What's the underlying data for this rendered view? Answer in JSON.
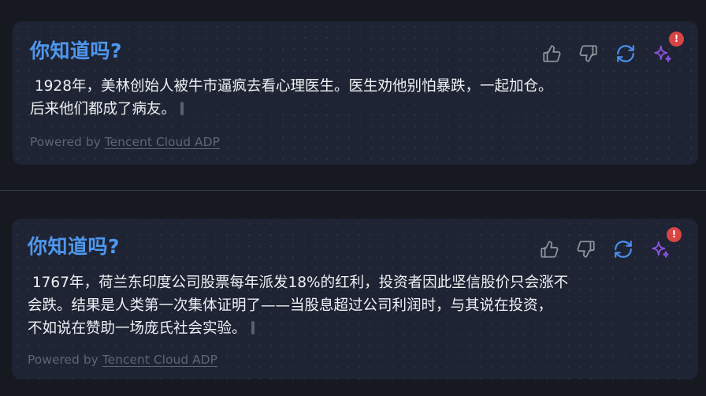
{
  "colors": {
    "background": "#16191f",
    "card": "#1e2433",
    "title": "#4f97ef",
    "body_text": "#eef0f4",
    "footer": "#5f6572",
    "icon_gray": "#8d929b",
    "refresh_blue": "#4a8ff0",
    "sparkle_purple": "#8c52e0",
    "badge_red": "#d84444"
  },
  "cards": [
    {
      "title": "你知道吗?",
      "lines": [
        " 1928年，美林创始人被牛市逼疯去看心理医生。医生劝他别怕暴跌，一起加仓。",
        "后来他们都成了病友。"
      ],
      "footer_prefix": "Powered by ",
      "footer_link": "Tencent Cloud ADP",
      "actions": {
        "like_icon": "thumbs-up-icon",
        "dislike_icon": "thumbs-down-icon",
        "refresh_icon": "refresh-icon",
        "sparkle_icon": "sparkle-icon",
        "badge": "!"
      }
    },
    {
      "title": "你知道吗?",
      "lines": [
        " 1767年，荷兰东印度公司股票每年派发18%的红利，投资者因此坚信股价只会涨不",
        "会跌。结果是人类第一次集体证明了——当股息超过公司利润时，与其说在投资，",
        "不如说在赞助一场庞氏社会实验。"
      ],
      "footer_prefix": "Powered by ",
      "footer_link": "Tencent Cloud ADP",
      "actions": {
        "like_icon": "thumbs-up-icon",
        "dislike_icon": "thumbs-down-icon",
        "refresh_icon": "refresh-icon",
        "sparkle_icon": "sparkle-icon",
        "badge": "!"
      }
    }
  ]
}
